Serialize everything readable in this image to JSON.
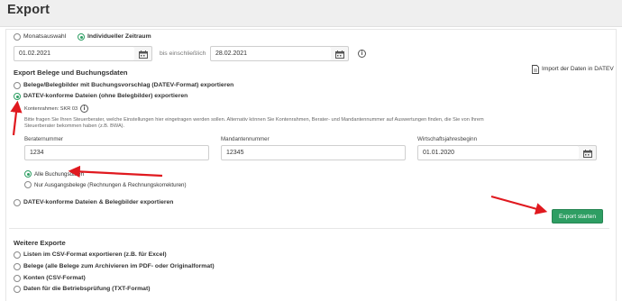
{
  "header": {
    "title": "Export"
  },
  "period": {
    "option_month": "Monatsauswahl",
    "option_custom": "Individueller Zeitraum",
    "from_date": "01.02.2021",
    "until_label": "bis einschließlich",
    "to_date": "28.02.2021"
  },
  "belege": {
    "section_title": "Export Belege und Buchungsdaten",
    "import_link": "Import der Daten in DATEV",
    "opt_belegbilder": "Belege/Belegbilder mit Buchungsvorschlag (DATEV-Format) exportieren",
    "opt_datev_konform": "DATEV-konforme Dateien (ohne Belegbilder) exportieren",
    "kontenrahmen_label": "Kontenrahmen: SKR 03",
    "hint_line1": "Bitte fragen Sie Ihren Steuerberater, welche Einstellungen hier eingetragen werden sollen. Alternativ können Sie Kontenrahmen, Berater- und Mandantennummer auf Auswertungen finden, die Sie von Ihrem",
    "hint_line2": "Steuerberater bekommen haben (z.B. BWA).",
    "berater_label": "Beraternummer",
    "berater_value": "1234",
    "mandant_label": "Mandantennummer",
    "mandant_value": "12345",
    "wj_label": "Wirtschaftsjahresbeginn",
    "wj_value": "01.01.2020",
    "opt_alle": "Alle Buchungsdaten",
    "opt_nur_ausgang": "Nur Ausgangsbelege (Rechnungen & Rechnungskorrekturen)",
    "opt_belegbilder2": "DATEV-konforme Dateien & Belegbilder exportieren",
    "export_button": "Export starten"
  },
  "weitere": {
    "section_title": "Weitere Exporte",
    "items": [
      "Listen im CSV-Format exportieren (z.B. für Excel)",
      "Belege (alle Belege zum Archivieren im PDF- oder Originalformat)",
      "Konten (CSV-Format)",
      "Daten für die Betriebsprüfung (TXT-Format)"
    ]
  },
  "colors": {
    "accent": "#2e9e63",
    "annotation_arrow": "#e0191f",
    "header_bg": "#efefef"
  },
  "icons": [
    "calendar-icon",
    "info-icon",
    "document-icon",
    "arrow-annotation"
  ]
}
